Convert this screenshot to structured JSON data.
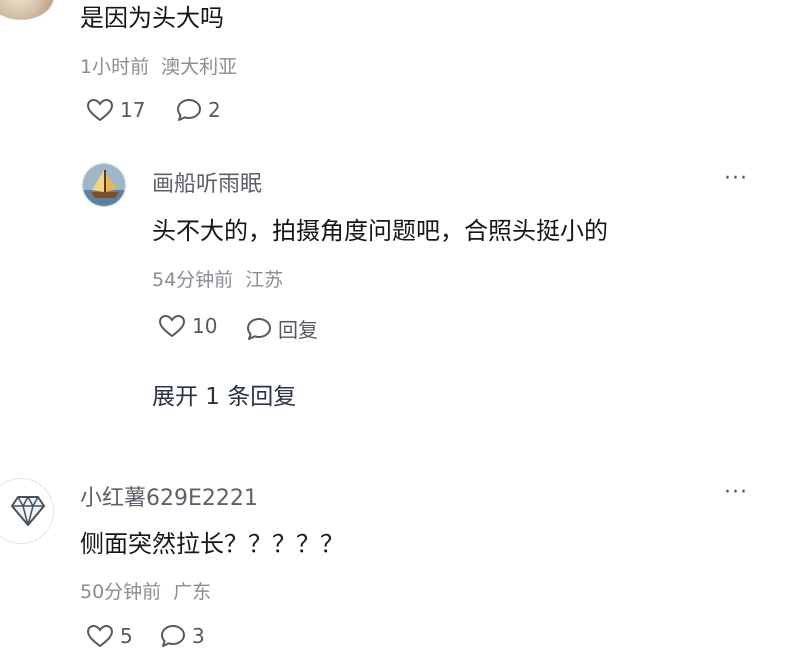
{
  "comment1": {
    "text": "是因为头大吗",
    "time": "1小时前",
    "location": "澳大利亚",
    "likes": "17",
    "replies": "2"
  },
  "reply1": {
    "username": "画船听雨眠",
    "text": "头不大的，拍摄角度问题吧，合照头挺小的",
    "time": "54分钟前",
    "location": "江苏",
    "likes": "10",
    "reply_label": "回复",
    "expand_label": "展开 1 条回复",
    "more": "···"
  },
  "comment2": {
    "username": "小红薯629E2221",
    "text": "侧面突然拉长？？？？？",
    "time": "50分钟前",
    "location": "广东",
    "likes": "5",
    "replies": "3",
    "more": "···"
  },
  "icons": {
    "like": "heart-outline-icon",
    "comment": "speech-bubble-icon",
    "more": "more-dots-icon"
  },
  "colors": {
    "text": "#161616",
    "meta": "#8a8d94",
    "icon": "#555a62"
  }
}
